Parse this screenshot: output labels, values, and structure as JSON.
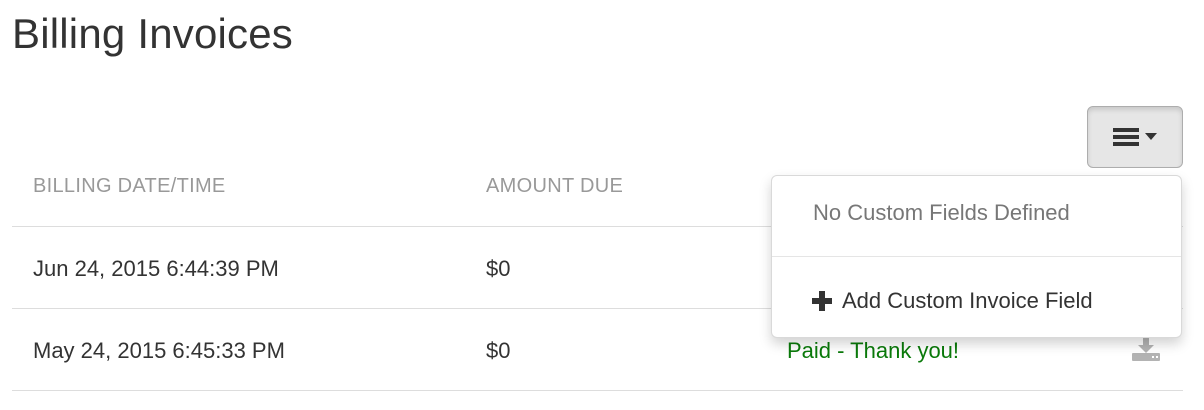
{
  "page": {
    "title": "Billing Invoices"
  },
  "toolbar": {
    "menu_icon": "hamburger-icon",
    "caret_icon": "caret-down-icon"
  },
  "table": {
    "headers": [
      "BILLING DATE/TIME",
      "AMOUNT DUE"
    ],
    "rows": [
      {
        "date": "Jun 24, 2015 6:44:39 PM",
        "amount": "$0",
        "status": ""
      },
      {
        "date": "May 24, 2015 6:45:33 PM",
        "amount": "$0",
        "status": "Paid - Thank you!"
      }
    ]
  },
  "dropdown": {
    "empty_label": "No Custom Fields Defined",
    "add_label": "Add Custom Invoice Field",
    "add_icon": "plus-icon"
  },
  "colors": {
    "paid": "#0a7a0a",
    "header_text": "#999999"
  }
}
